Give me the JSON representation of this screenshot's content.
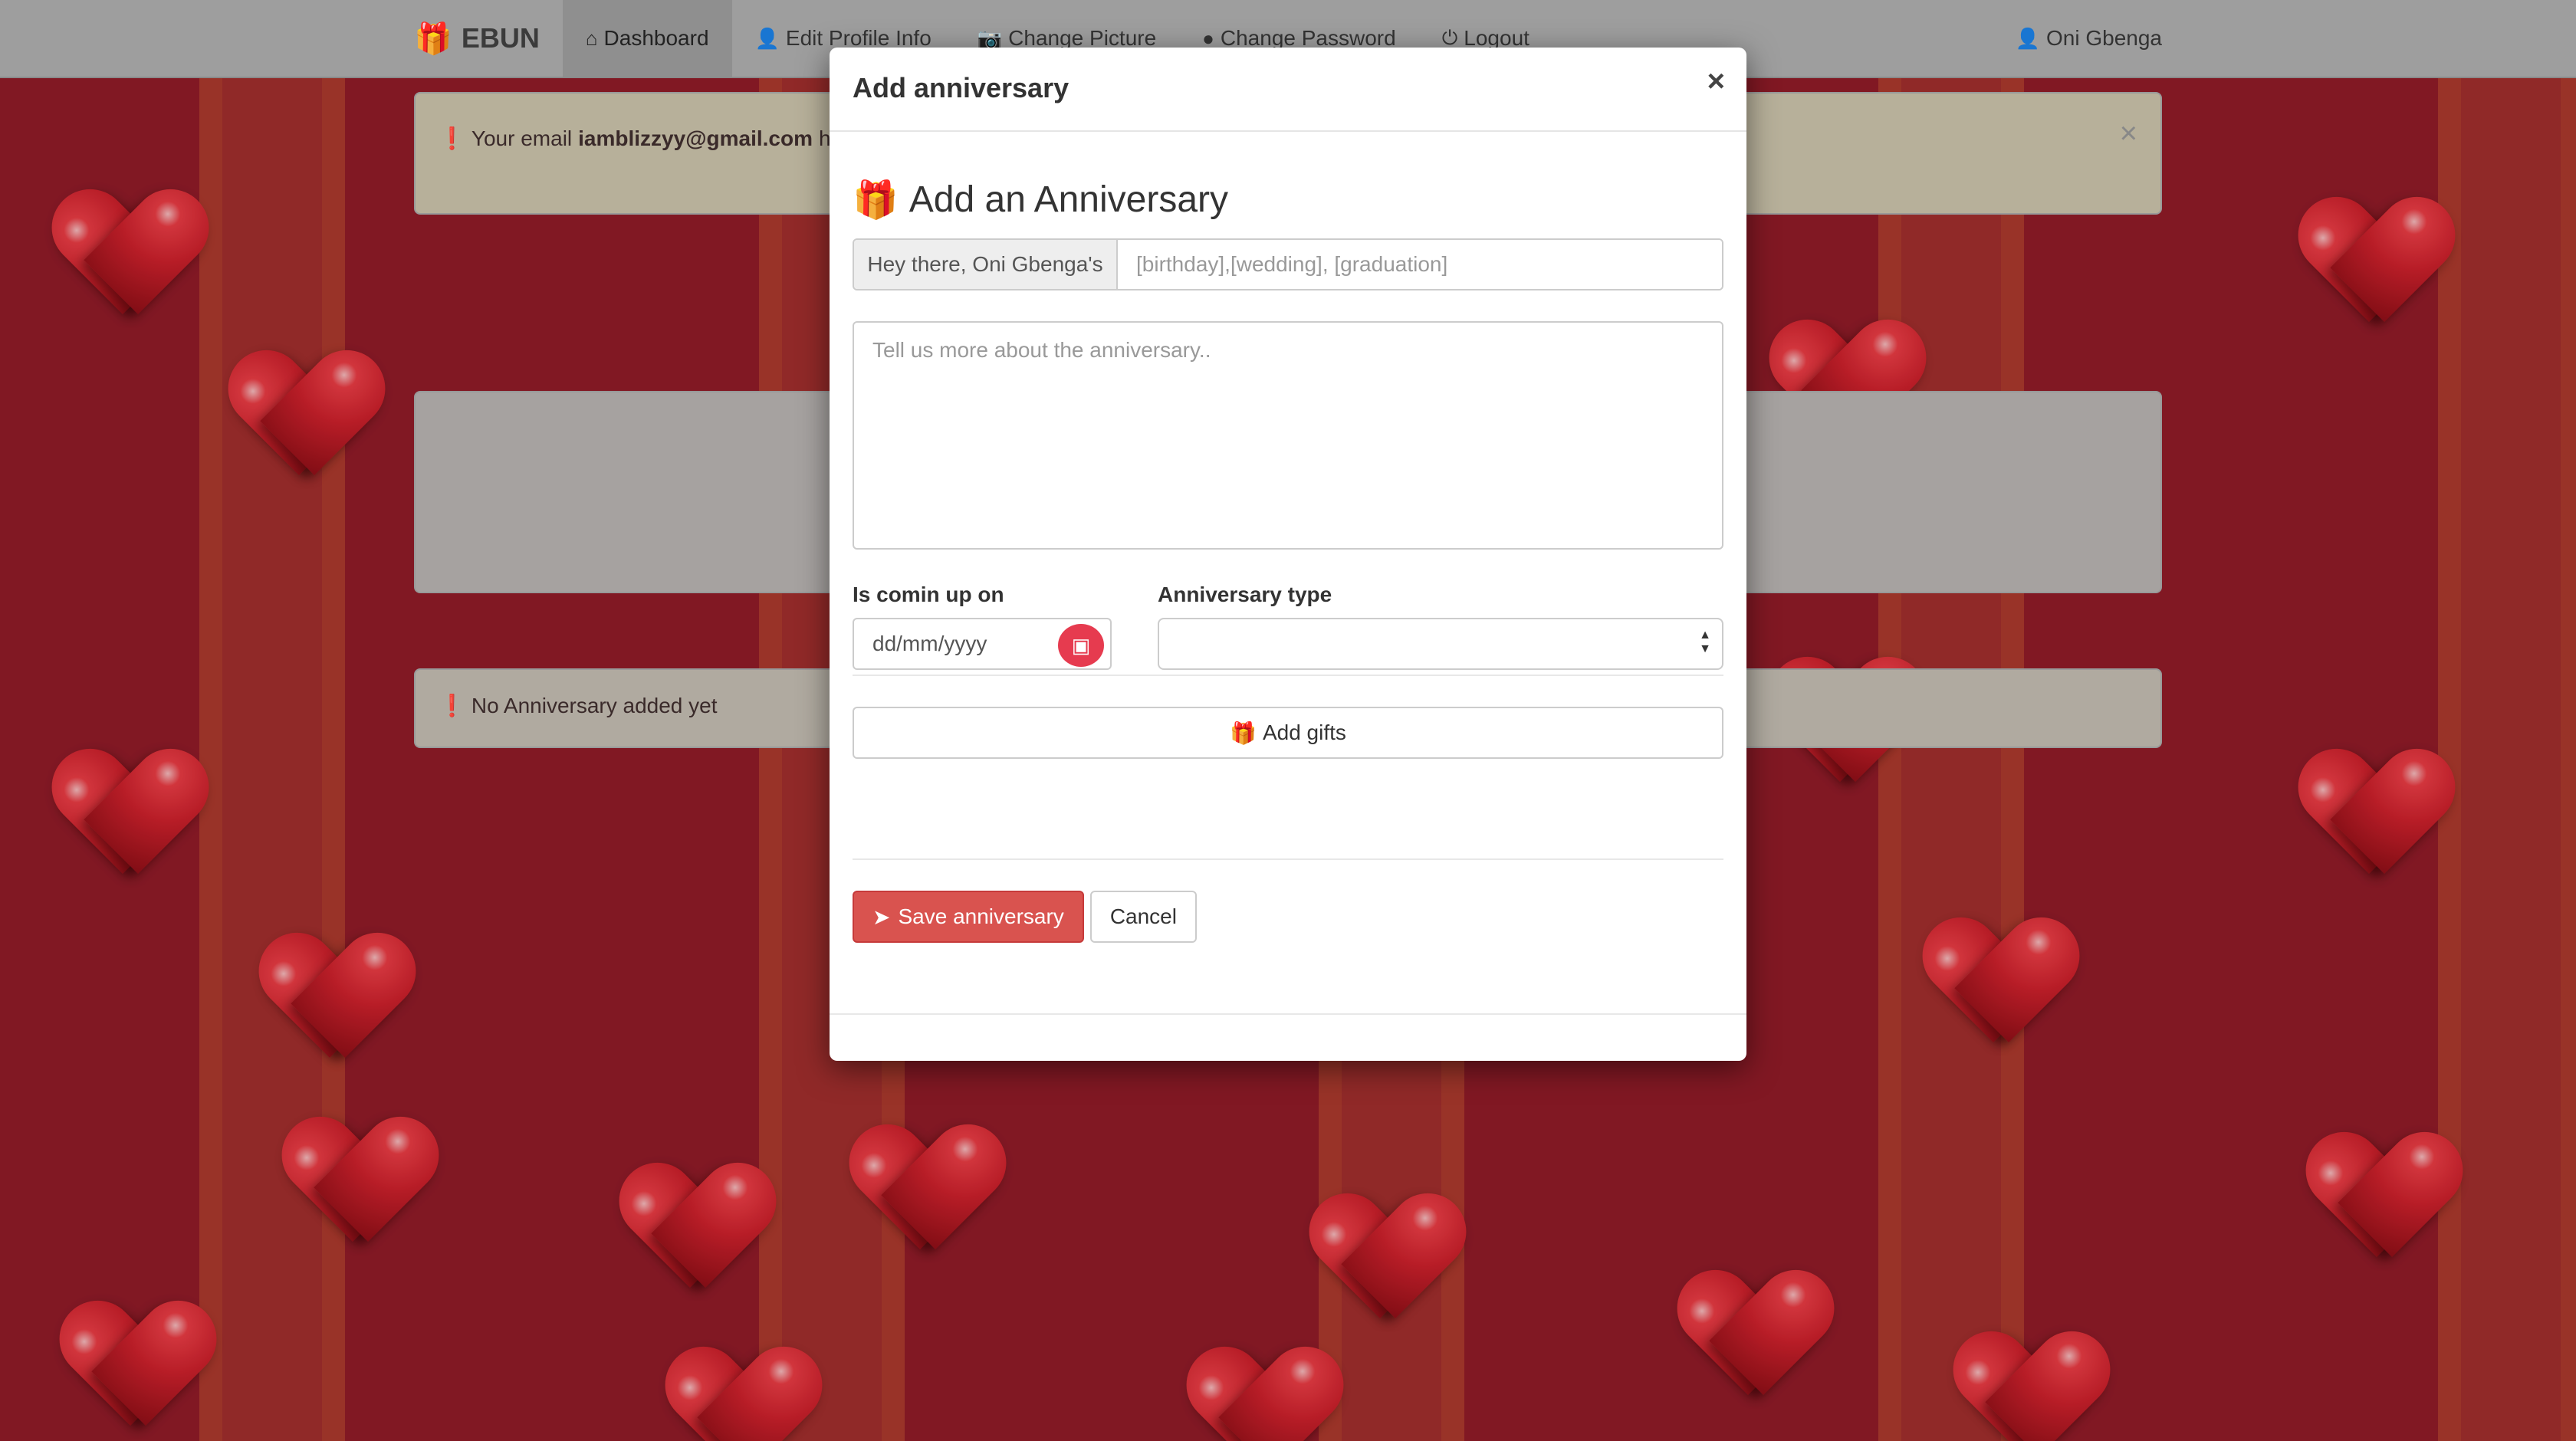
{
  "navbar": {
    "brand": "EBUN",
    "items": [
      {
        "label": "Dashboard",
        "icon": "gift-icon"
      },
      {
        "label": "Edit Profile Info",
        "icon": "user-icon"
      },
      {
        "label": "Change Picture",
        "icon": "camera-icon"
      },
      {
        "label": "Change Password",
        "icon": "circle-icon"
      },
      {
        "label": "Logout",
        "icon": "power-icon"
      }
    ],
    "user": "Oni Gbenga"
  },
  "background": {
    "alert_prefix": "Your email",
    "alert_email": "iamblizzyy@gmail.com",
    "alert_suffix": "has",
    "no_anniversary": "No Anniversary added yet"
  },
  "modal": {
    "title": "Add anniversary",
    "close": "×",
    "heading": "Add an Anniversary",
    "greeting_addon": "Hey there, Oni Gbenga's",
    "name_placeholder": "[birthday],[wedding], [graduation]",
    "description_placeholder": "Tell us more about the anniversary..",
    "date_label": "Is comin up on",
    "date_placeholder": "dd/mm/yyyy",
    "type_label": "Anniversary type",
    "type_value": "",
    "add_gifts": "Add gifts",
    "save": "Save anniversary",
    "cancel": "Cancel"
  },
  "colors": {
    "primary_red": "#d9534f",
    "gift_red": "#d93a4c",
    "background": "#8c1b27"
  }
}
